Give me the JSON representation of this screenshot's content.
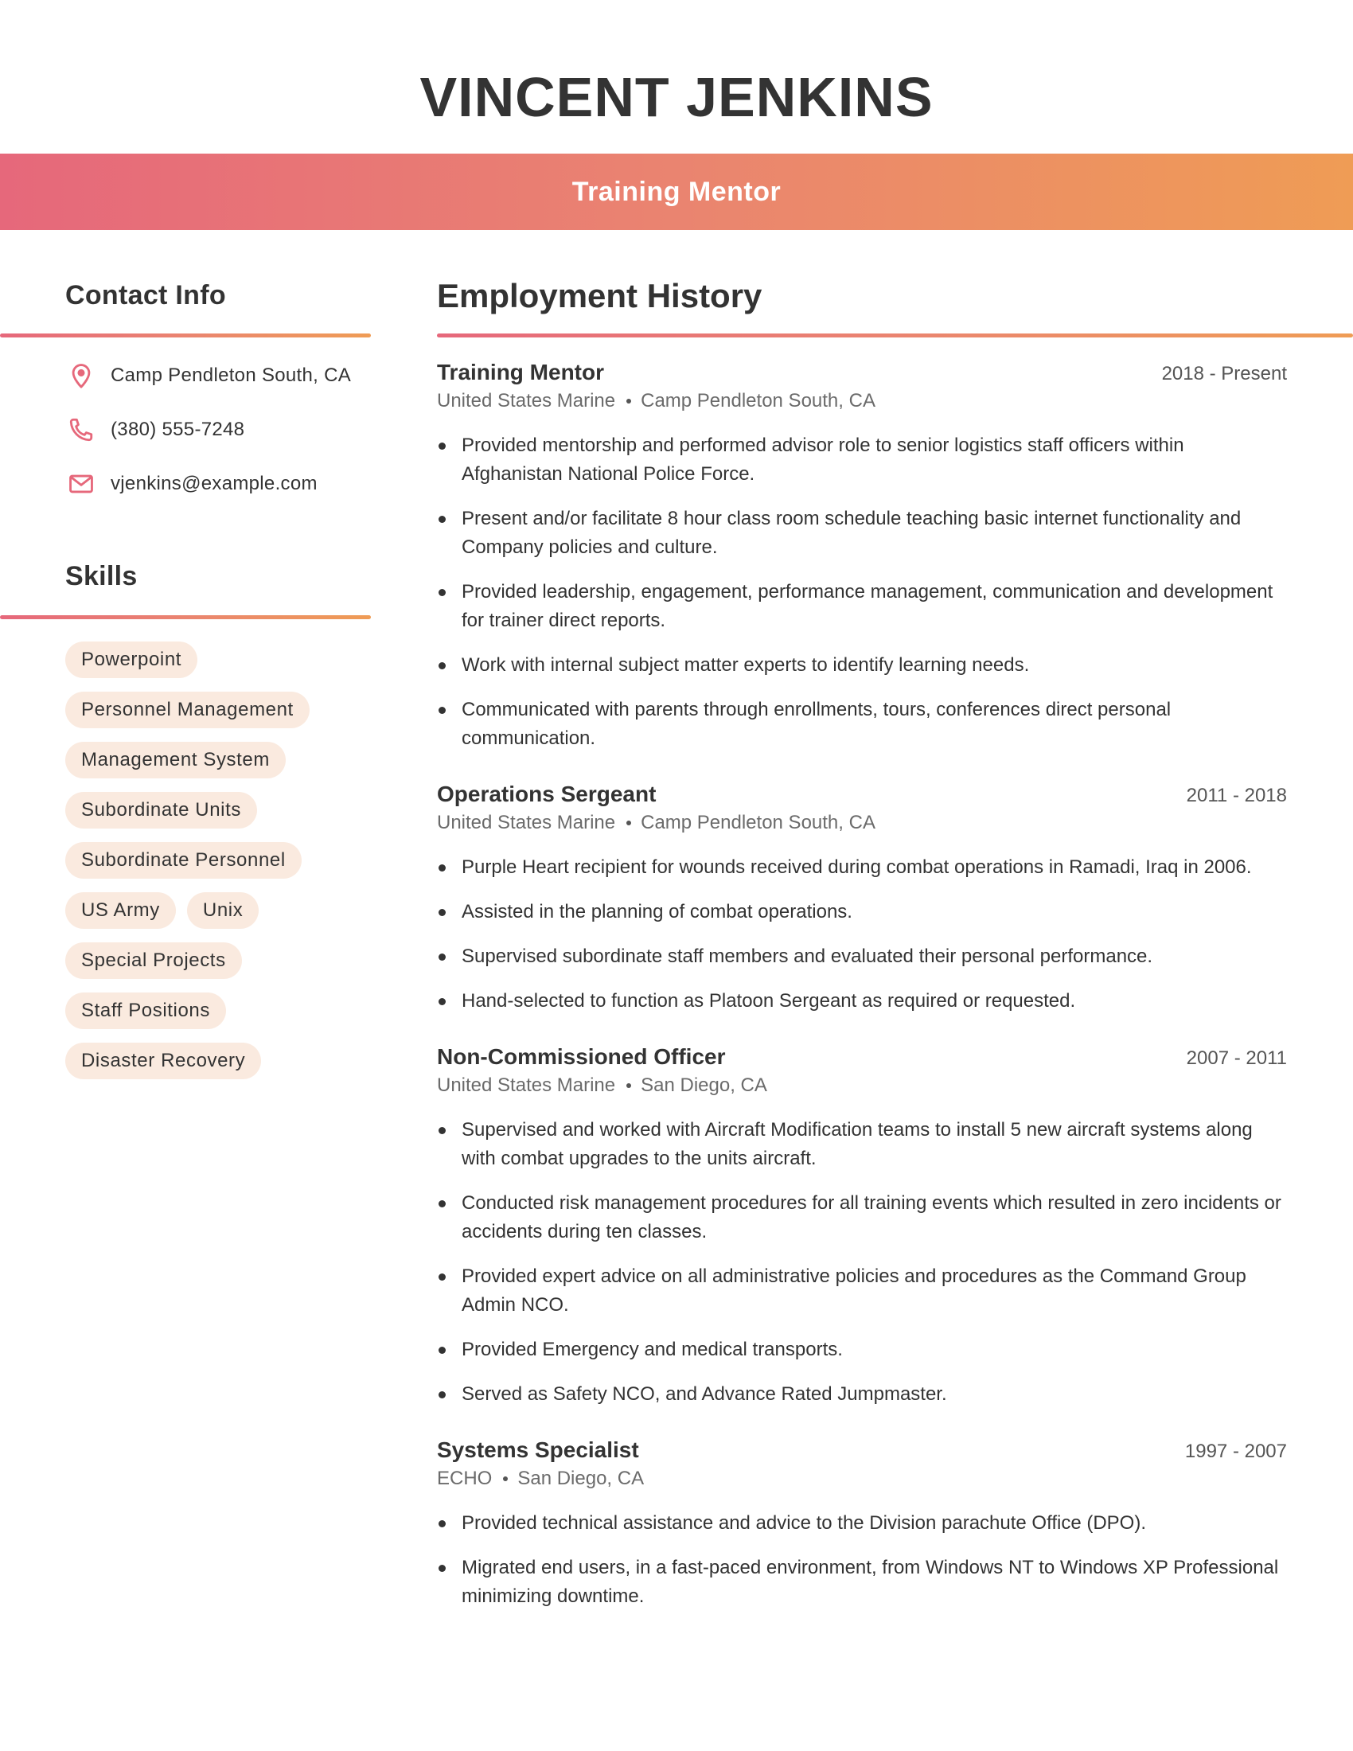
{
  "header": {
    "name": "VINCENT JENKINS",
    "title": "Training Mentor"
  },
  "colors": {
    "gradient_start": "#E6687B",
    "gradient_end": "#EF9C55",
    "pill_bg": "#FAEADF",
    "icon": "#E6687B",
    "text": "#333333"
  },
  "contact": {
    "heading": "Contact Info",
    "items": [
      {
        "icon": "location-pin-icon",
        "text": "Camp Pendleton South, CA"
      },
      {
        "icon": "phone-icon",
        "text": "(380) 555-7248"
      },
      {
        "icon": "mail-icon",
        "text": "vjenkins@example.com"
      }
    ]
  },
  "skills": {
    "heading": "Skills",
    "items": [
      "Powerpoint",
      "Personnel Management",
      "Management System",
      "Subordinate Units",
      "Subordinate Personnel",
      "US Army",
      "Unix",
      "Special Projects",
      "Staff Positions",
      "Disaster Recovery"
    ]
  },
  "employment": {
    "heading": "Employment History",
    "jobs": [
      {
        "title": "Training Mentor",
        "dates": "2018 - Present",
        "company": "United States Marine",
        "location": "Camp Pendleton South, CA",
        "bullets": [
          "Provided mentorship and performed advisor role to senior logistics staff officers within Afghanistan National Police Force.",
          "Present and/or facilitate 8 hour class room schedule teaching basic internet functionality and Company policies and culture.",
          "Provided leadership, engagement, performance management, communication and development for trainer direct reports.",
          "Work with internal subject matter experts to identify learning needs.",
          "Communicated with parents through enrollments, tours, conferences direct personal communication."
        ]
      },
      {
        "title": "Operations Sergeant",
        "dates": "2011 - 2018",
        "company": "United States Marine",
        "location": "Camp Pendleton South, CA",
        "bullets": [
          "Purple Heart recipient for wounds received during combat operations in Ramadi, Iraq in 2006.",
          "Assisted in the planning of combat operations.",
          "Supervised subordinate staff members and evaluated their personal performance.",
          "Hand-selected to function as Platoon Sergeant as required or requested."
        ]
      },
      {
        "title": "Non-Commissioned Officer",
        "dates": "2007 - 2011",
        "company": "United States Marine",
        "location": "San Diego, CA",
        "bullets": [
          "Supervised and worked with Aircraft Modification teams to install 5 new aircraft systems along with combat upgrades to the units aircraft.",
          "Conducted risk management procedures for all training events which resulted in zero incidents or accidents during ten classes.",
          "Provided expert advice on all administrative policies and procedures as the Command Group Admin NCO.",
          "Provided Emergency and medical transports.",
          "Served as Safety NCO, and Advance Rated Jumpmaster."
        ]
      },
      {
        "title": "Systems Specialist",
        "dates": "1997 - 2007",
        "company": "ECHO",
        "location": "San Diego, CA",
        "bullets": [
          "Provided technical assistance and advice to the Division parachute Office (DPO).",
          "Migrated end users, in a fast-paced environment, from Windows NT to Windows XP Professional minimizing downtime."
        ]
      }
    ]
  }
}
